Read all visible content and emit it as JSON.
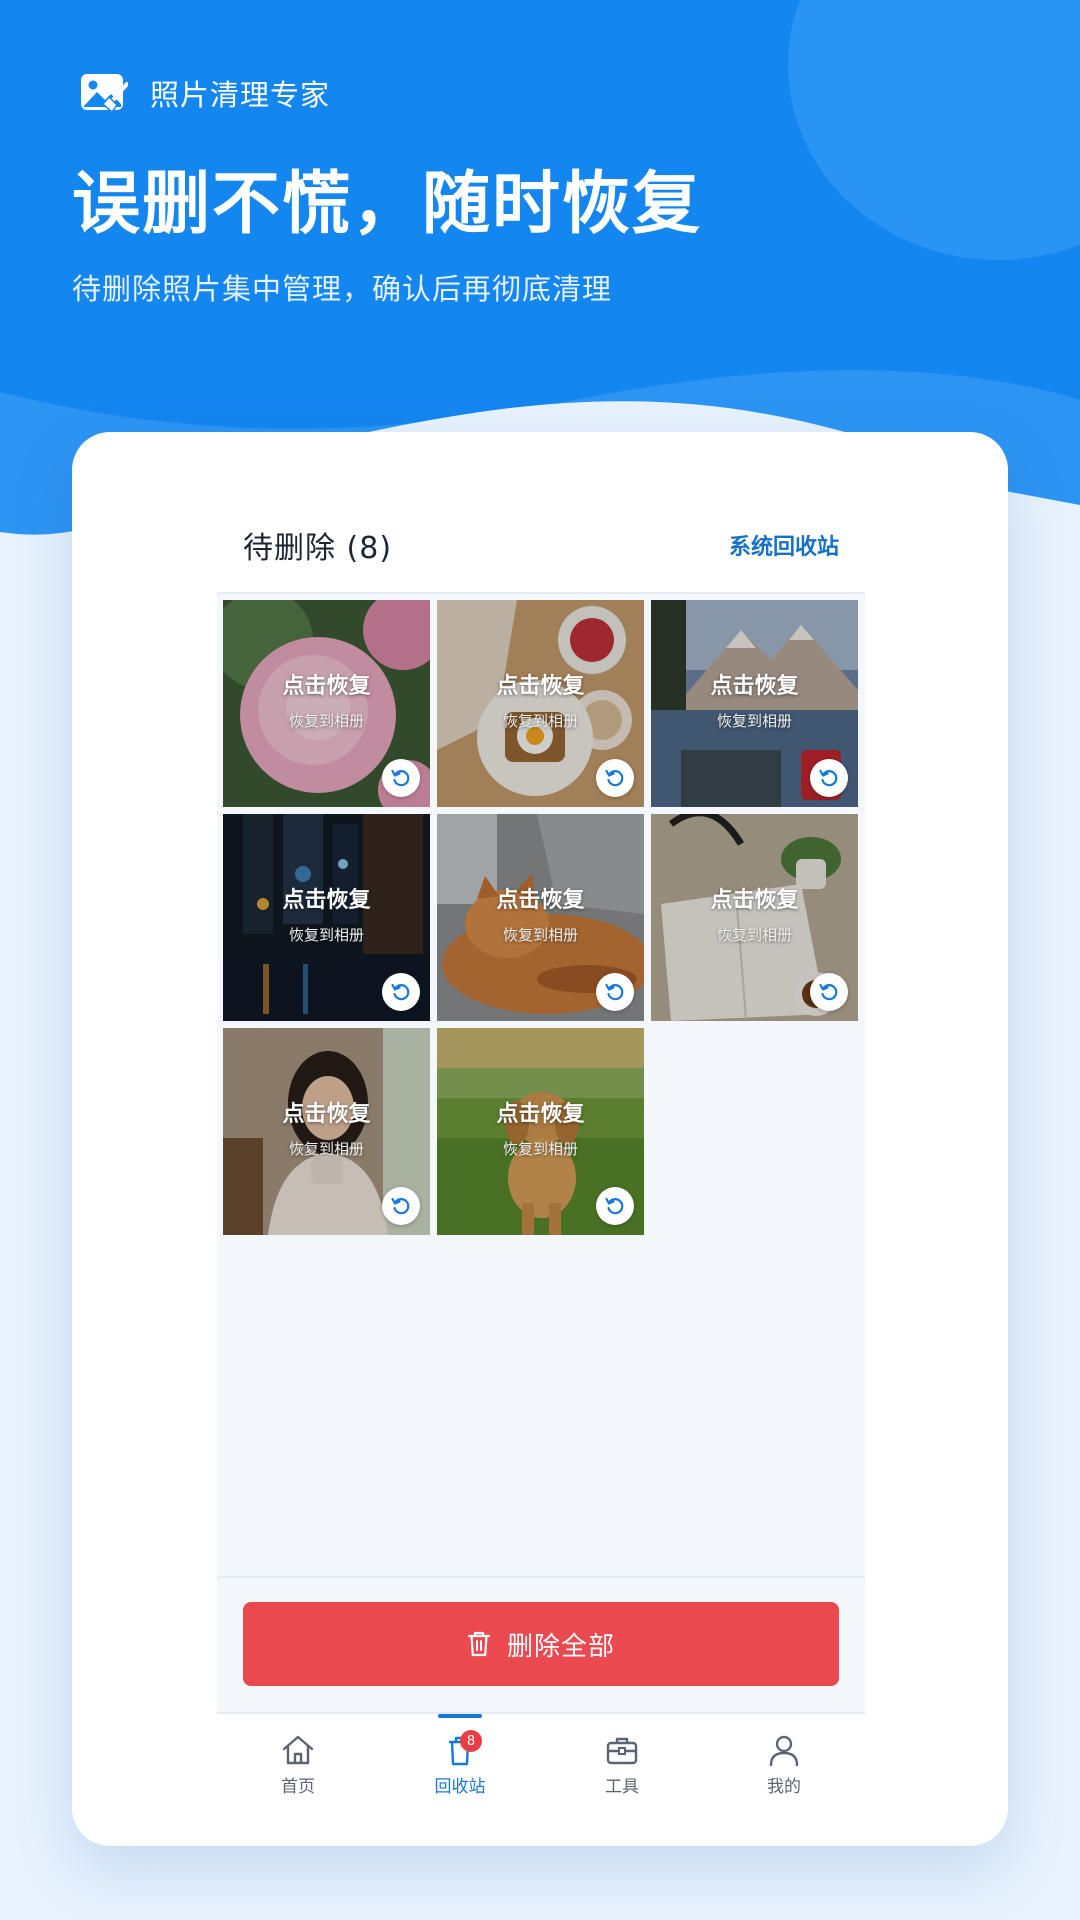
{
  "app": {
    "name": "照片清理专家",
    "logo_icon": "photo-broom-icon"
  },
  "hero": {
    "headline": "误删不慌，随时恢复",
    "subline": "待删除照片集中管理，确认后再彻底清理"
  },
  "panel": {
    "title": "待删除 (8)",
    "system_link": "系统回收站"
  },
  "photos": [
    {
      "subject": "pink peony flower",
      "restore_label": "点击恢复",
      "restore_sub": "恢复到相册"
    },
    {
      "subject": "breakfast with egg toast and strawberries",
      "restore_label": "点击恢复",
      "restore_sub": "恢复到相册"
    },
    {
      "subject": "mountain lake at sunset",
      "restore_label": "点击恢复",
      "restore_sub": "恢复到相册"
    },
    {
      "subject": "rainy night city street",
      "restore_label": "点击恢复",
      "restore_sub": "恢复到相册"
    },
    {
      "subject": "ginger cat sleeping on sofa",
      "restore_label": "点击恢复",
      "restore_sub": "恢复到相册"
    },
    {
      "subject": "desk with notebook, headphones and plant",
      "restore_label": "点击恢复",
      "restore_sub": "恢复到相册"
    },
    {
      "subject": "woman holding a cup in cafe",
      "restore_label": "点击恢复",
      "restore_sub": "恢复到相册"
    },
    {
      "subject": "golden retriever running on grass",
      "restore_label": "点击恢复",
      "restore_sub": "恢复到相册"
    }
  ],
  "delete_all": {
    "label": "删除全部",
    "icon": "trash-icon"
  },
  "tabbar": {
    "items": [
      {
        "label": "首页",
        "icon": "home-icon"
      },
      {
        "label": "回收站",
        "icon": "recycle-bin-icon",
        "badge": "8",
        "active": true
      },
      {
        "label": "工具",
        "icon": "toolbox-icon"
      },
      {
        "label": "我的",
        "icon": "user-icon"
      }
    ]
  },
  "colors": {
    "brand_blue": "#1486f0",
    "danger_red": "#e9494f",
    "active_tab": "#1679d8"
  }
}
